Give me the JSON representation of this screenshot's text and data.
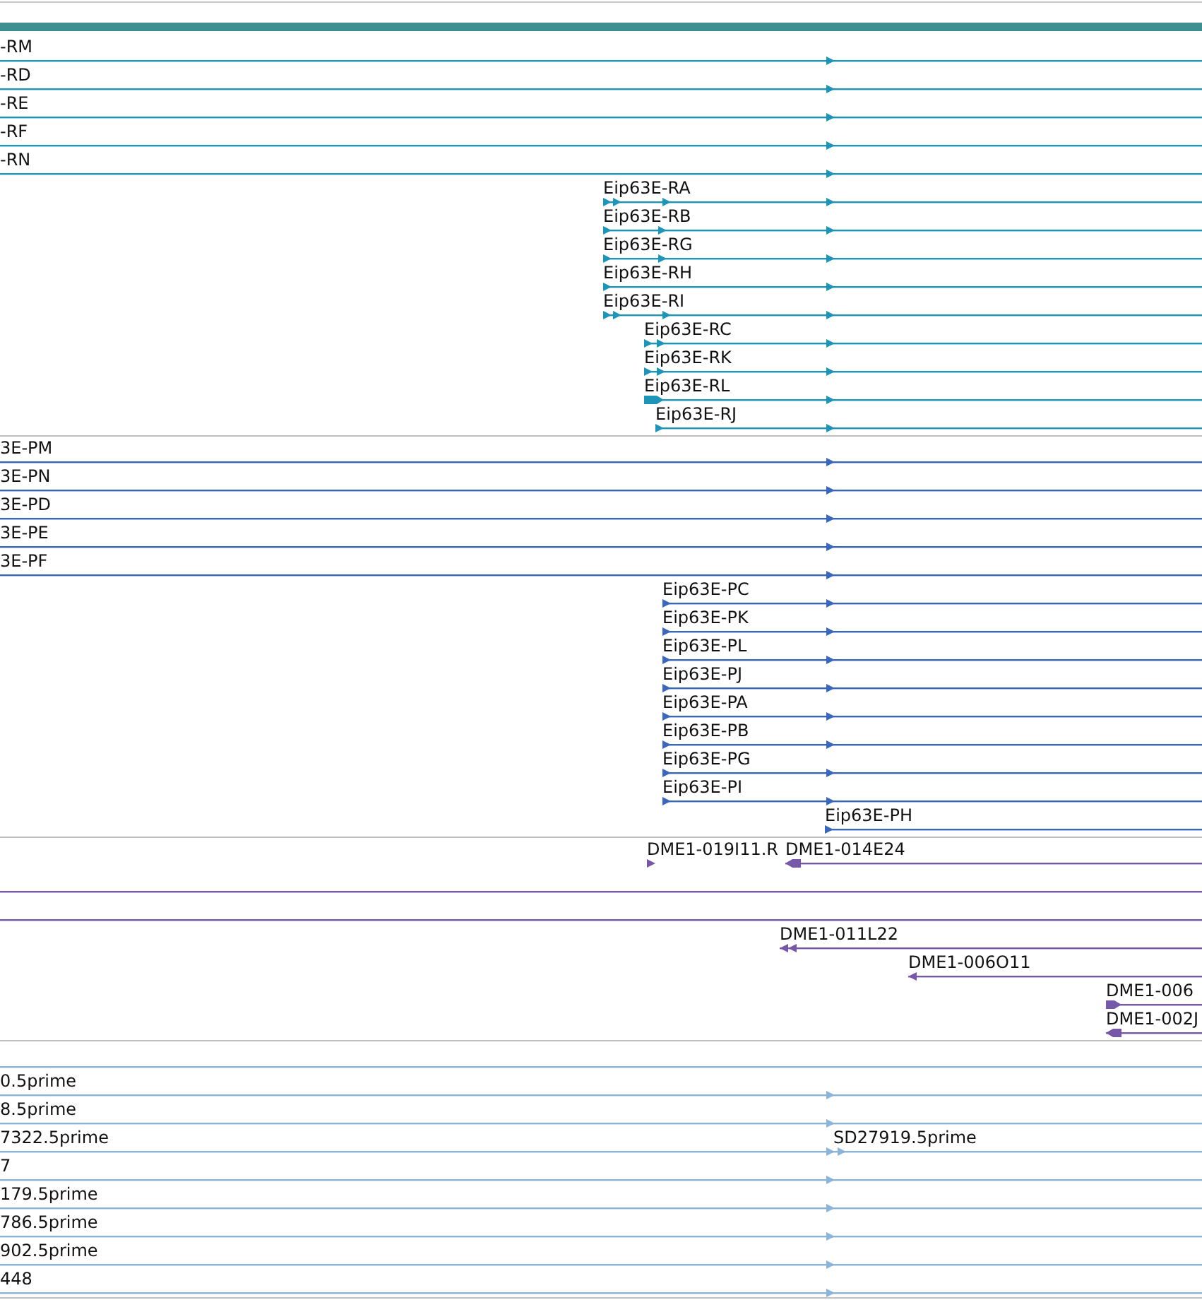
{
  "tracks": [
    {
      "color": "#1c95b6",
      "features": [
        {
          "kind": "row",
          "label": "-RM"
        },
        {
          "kind": "row",
          "label": "-RD"
        },
        {
          "kind": "row",
          "label": "-RE"
        },
        {
          "kind": "row",
          "label": "-RF"
        },
        {
          "kind": "row",
          "label": "-RN"
        },
        {
          "kind": "row",
          "label": "Eip63E-RA"
        },
        {
          "kind": "row",
          "label": "Eip63E-RB"
        },
        {
          "kind": "row",
          "label": "Eip63E-RG"
        },
        {
          "kind": "row",
          "label": "Eip63E-RH"
        },
        {
          "kind": "row",
          "label": "Eip63E-RI"
        },
        {
          "kind": "row",
          "label": "Eip63E-RC"
        },
        {
          "kind": "row",
          "label": "Eip63E-RK"
        },
        {
          "kind": "row",
          "label": "Eip63E-RL"
        },
        {
          "kind": "row",
          "label": "Eip63E-RJ"
        }
      ]
    },
    {
      "color": "#3a66bb",
      "features": [
        {
          "kind": "row",
          "label": "3E-PM"
        },
        {
          "kind": "row",
          "label": "3E-PN"
        },
        {
          "kind": "row",
          "label": "3E-PD"
        },
        {
          "kind": "row",
          "label": "3E-PE"
        },
        {
          "kind": "row",
          "label": "3E-PF"
        },
        {
          "kind": "row",
          "label": "Eip63E-PC"
        },
        {
          "kind": "row",
          "label": "Eip63E-PK"
        },
        {
          "kind": "row",
          "label": "Eip63E-PL"
        },
        {
          "kind": "row",
          "label": "Eip63E-PJ"
        },
        {
          "kind": "row",
          "label": "Eip63E-PA"
        },
        {
          "kind": "row",
          "label": "Eip63E-PB"
        },
        {
          "kind": "row",
          "label": "Eip63E-PG"
        },
        {
          "kind": "row",
          "label": "Eip63E-PI"
        },
        {
          "kind": "row",
          "label": "Eip63E-PH"
        }
      ]
    },
    {
      "color": "#7657a8",
      "features": [
        {
          "kind": "row",
          "label": "DME1-019I11.R",
          "reverse": false
        },
        {
          "kind": "same-row",
          "label": "DME1-014E24",
          "reverse": true
        },
        {
          "kind": "blank"
        },
        {
          "kind": "blank"
        },
        {
          "kind": "row",
          "label": "DME1-011L22",
          "reverse": true
        },
        {
          "kind": "row",
          "label": "DME1-006O11",
          "reverse": true
        },
        {
          "kind": "row",
          "label": "DME1-006",
          "reverse": false
        },
        {
          "kind": "row",
          "label": "DME1-002J",
          "reverse": true
        }
      ]
    },
    {
      "color": "#8ab4d8",
      "features": [
        {
          "kind": "blank"
        },
        {
          "kind": "row",
          "label": "0.5prime"
        },
        {
          "kind": "row",
          "label": "8.5prime"
        },
        {
          "kind": "row",
          "label": "7322.5prime"
        },
        {
          "kind": "same-row",
          "label": "SD27919.5prime"
        },
        {
          "kind": "row",
          "label": "7"
        },
        {
          "kind": "row",
          "label": "179.5prime"
        },
        {
          "kind": "row",
          "label": "786.5prime"
        },
        {
          "kind": "row",
          "label": "902.5prime"
        },
        {
          "kind": "row",
          "label": "448"
        }
      ]
    }
  ]
}
